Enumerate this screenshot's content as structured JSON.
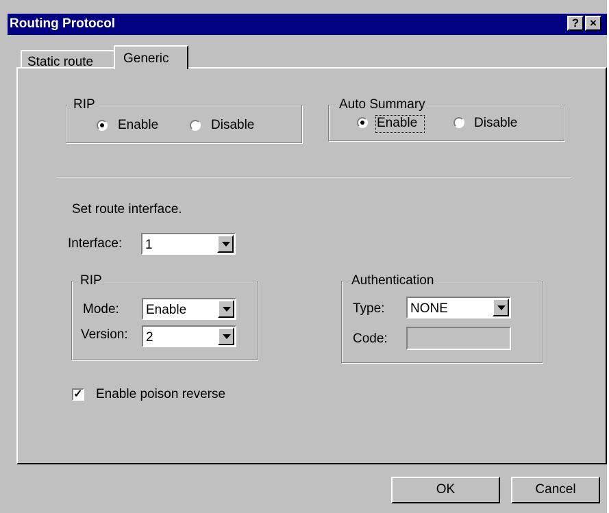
{
  "window": {
    "title": "Routing Protocol",
    "help_btn": "?",
    "close_btn": "×"
  },
  "tabs": [
    {
      "label": "Static route"
    },
    {
      "label": "Generic"
    }
  ],
  "rip_group": {
    "legend": "RIP",
    "enable": "Enable",
    "disable": "Disable",
    "selected": "Enable"
  },
  "auto_summary": {
    "legend": "Auto Summary",
    "enable": "Enable",
    "disable": "Disable",
    "selected": "Enable"
  },
  "route_interface_text": "Set route interface.",
  "interface": {
    "label": "Interface:",
    "value": "1"
  },
  "rip_settings": {
    "legend": "RIP",
    "mode_label": "Mode:",
    "mode_value": "Enable",
    "version_label": "Version:",
    "version_value": "2"
  },
  "authentication": {
    "legend": "Authentication",
    "type_label": "Type:",
    "type_value": "NONE",
    "code_label": "Code:",
    "code_value": ""
  },
  "poison_reverse": {
    "label": "Enable poison reverse",
    "checked": true,
    "mark": "✓"
  },
  "buttons": {
    "ok": "OK",
    "cancel": "Cancel"
  }
}
